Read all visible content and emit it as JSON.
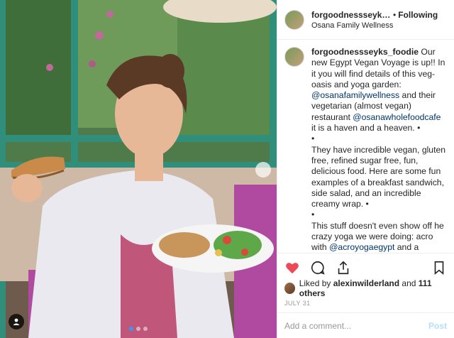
{
  "header": {
    "username": "forgoodnessseyks_foodie",
    "separator": "•",
    "follow_label": "Following",
    "location": "Osana Family Wellness"
  },
  "caption": {
    "username": "forgoodnessseyks_foodie",
    "p1_a": " Our new Egypt Vegan Voyage is up!! In it you will find details of this veg-oasis and yoga garden: ",
    "mention_1": "@osanafamilywellness",
    "p1_b": " and their vegetarian (almost vegan) restaurant ",
    "mention_2": "@osanawholefoodcafe",
    "p1_c": " it is a haven and a heaven. •",
    "bullet_1": "•",
    "p2": "They have incredible vegan, gluten free, refined sugar free, fun, delicious food. Here are some fun examples of a breakfast sandwich, side salad, and an incredible creamy wrap. •",
    "bullet_2": "•",
    "p3_a": "This stuff doesn't even show off he crazy yoga we were doing: acro with ",
    "mention_3": "@acroyogaegypt",
    "p3_b": " and a bungee yoga class! What an amazing day. Thank you Osana!!",
    "bullet_3": "•"
  },
  "actions": {
    "like_icon": "heart-icon",
    "comment_icon": "comment-icon",
    "share_icon": "share-icon",
    "save_icon": "bookmark-icon"
  },
  "likes": {
    "prefix": "Liked by ",
    "user": "alexinwilderland",
    "middle": " and ",
    "count": "111 others"
  },
  "date": "JULY 31",
  "comment": {
    "placeholder": "Add a comment...",
    "post_label": "Post"
  },
  "colors": {
    "like_red": "#ed4956",
    "mention_blue": "#003569",
    "post_blue": "#b2dffc"
  }
}
